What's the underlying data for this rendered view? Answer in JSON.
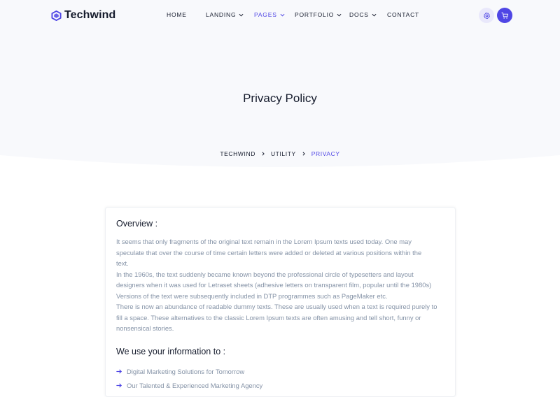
{
  "brand": {
    "name": "Techwind"
  },
  "nav": {
    "items": [
      {
        "label": "Home",
        "dropdown": false,
        "active": false
      },
      {
        "label": "Landing",
        "dropdown": true,
        "active": false
      },
      {
        "label": "Pages",
        "dropdown": true,
        "active": true
      },
      {
        "label": "Portfolio",
        "dropdown": true,
        "active": false
      },
      {
        "label": "Docs",
        "dropdown": true,
        "active": false
      },
      {
        "label": "Contact",
        "dropdown": false,
        "active": false
      }
    ],
    "settings_icon": "gear-icon",
    "cart_icon": "cart-icon"
  },
  "hero": {
    "title": "Privacy Policy",
    "breadcrumb": [
      "Techwind",
      "Utility",
      "Privacy"
    ]
  },
  "content": {
    "overview_heading": "Overview :",
    "overview_lines": [
      "It seems that only fragments of the original text remain in the Lorem Ipsum texts used today. One may",
      "speculate that over the course of time certain letters were added or deleted at various positions within the",
      "text.",
      "In the 1960s, the text suddenly became known beyond the professional circle of typesetters and layout",
      "designers when it was used for Letraset sheets (adhesive letters on transparent film, popular until the 1980s)",
      "Versions of the text were subsequently included in DTP programmes such as PageMaker etc.",
      "There is now an abundance of readable dummy texts. These are usually used when a text is required purely to",
      "fill a space. These alternatives to the classic Lorem Ipsum texts are often amusing and tell short, funny or",
      "nonsensical stories."
    ],
    "use_heading": "We use your information to :",
    "use_items": [
      "Digital Marketing Solutions for Tomorrow",
      "Our Talented & Experienced Marketing Agency"
    ]
  },
  "colors": {
    "accent": "#4f46e5",
    "text_dark": "#161c2d",
    "text_muted": "#8492a6",
    "hero_bg": "#f8f9fc"
  }
}
